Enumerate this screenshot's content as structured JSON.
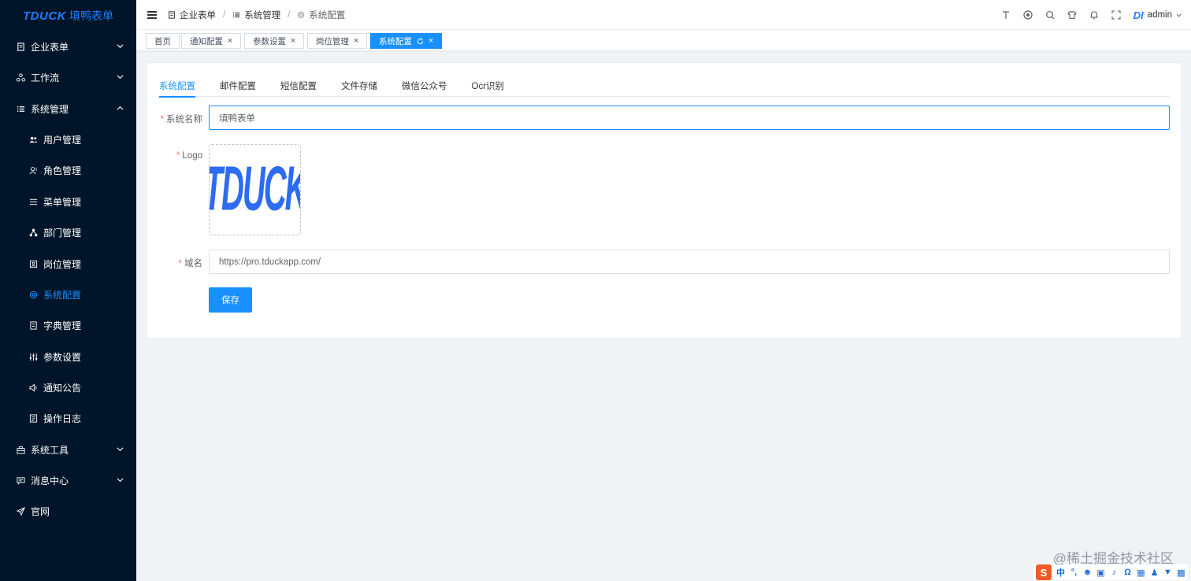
{
  "brand": {
    "logo": "TDUCK",
    "name": "填鸭表单"
  },
  "sidebar": {
    "items": [
      {
        "label": "企业表单",
        "icon": "document-icon",
        "level": 1,
        "expand": "down"
      },
      {
        "label": "工作流",
        "icon": "workflow-icon",
        "level": 1,
        "expand": "down"
      },
      {
        "label": "系统管理",
        "icon": "list-icon",
        "level": 1,
        "expand": "up"
      },
      {
        "label": "用户管理",
        "icon": "users-icon",
        "level": 2
      },
      {
        "label": "角色管理",
        "icon": "role-icon",
        "level": 2
      },
      {
        "label": "菜单管理",
        "icon": "menu-icon",
        "level": 2
      },
      {
        "label": "部门管理",
        "icon": "org-icon",
        "level": 2
      },
      {
        "label": "岗位管理",
        "icon": "post-icon",
        "level": 2
      },
      {
        "label": "系统配置",
        "icon": "gear-icon",
        "level": 2,
        "active": true
      },
      {
        "label": "字典管理",
        "icon": "dict-icon",
        "level": 2
      },
      {
        "label": "参数设置",
        "icon": "sliders-icon",
        "level": 2
      },
      {
        "label": "通知公告",
        "icon": "speaker-icon",
        "level": 2
      },
      {
        "label": "操作日志",
        "icon": "log-icon",
        "level": 2
      },
      {
        "label": "系统工具",
        "icon": "toolbox-icon",
        "level": 1,
        "expand": "down"
      },
      {
        "label": "消息中心",
        "icon": "message-icon",
        "level": 1,
        "expand": "down"
      },
      {
        "label": "官网",
        "icon": "send-icon",
        "level": 1
      }
    ]
  },
  "breadcrumb": {
    "items": [
      "企业表单",
      "系统管理",
      "系统配置"
    ]
  },
  "header": {
    "username": "admin",
    "avatar_text": "DI"
  },
  "tags": [
    {
      "label": "首页",
      "closable": false
    },
    {
      "label": "通知配置",
      "closable": true
    },
    {
      "label": "参数设置",
      "closable": true
    },
    {
      "label": "岗位管理",
      "closable": true
    },
    {
      "label": "系统配置",
      "closable": true,
      "active": true
    }
  ],
  "config_tabs": [
    "系统配置",
    "邮件配置",
    "短信配置",
    "文件存储",
    "微信公众号",
    "Ocr识别"
  ],
  "form": {
    "name_label": "系统名称",
    "name_value": "填鸭表单",
    "logo_label": "Logo",
    "logo_image_text": "TDUCK",
    "domain_label": "域名",
    "domain_value": "https://pro.tduckapp.com/",
    "save_label": "保存"
  },
  "watermark": "@稀土掘金技术社区",
  "ime": {
    "logo": "S",
    "lang": "中"
  },
  "colors": {
    "sidebar_bg": "#001529",
    "accent": "#1890ff",
    "required": "#f56c6c"
  }
}
